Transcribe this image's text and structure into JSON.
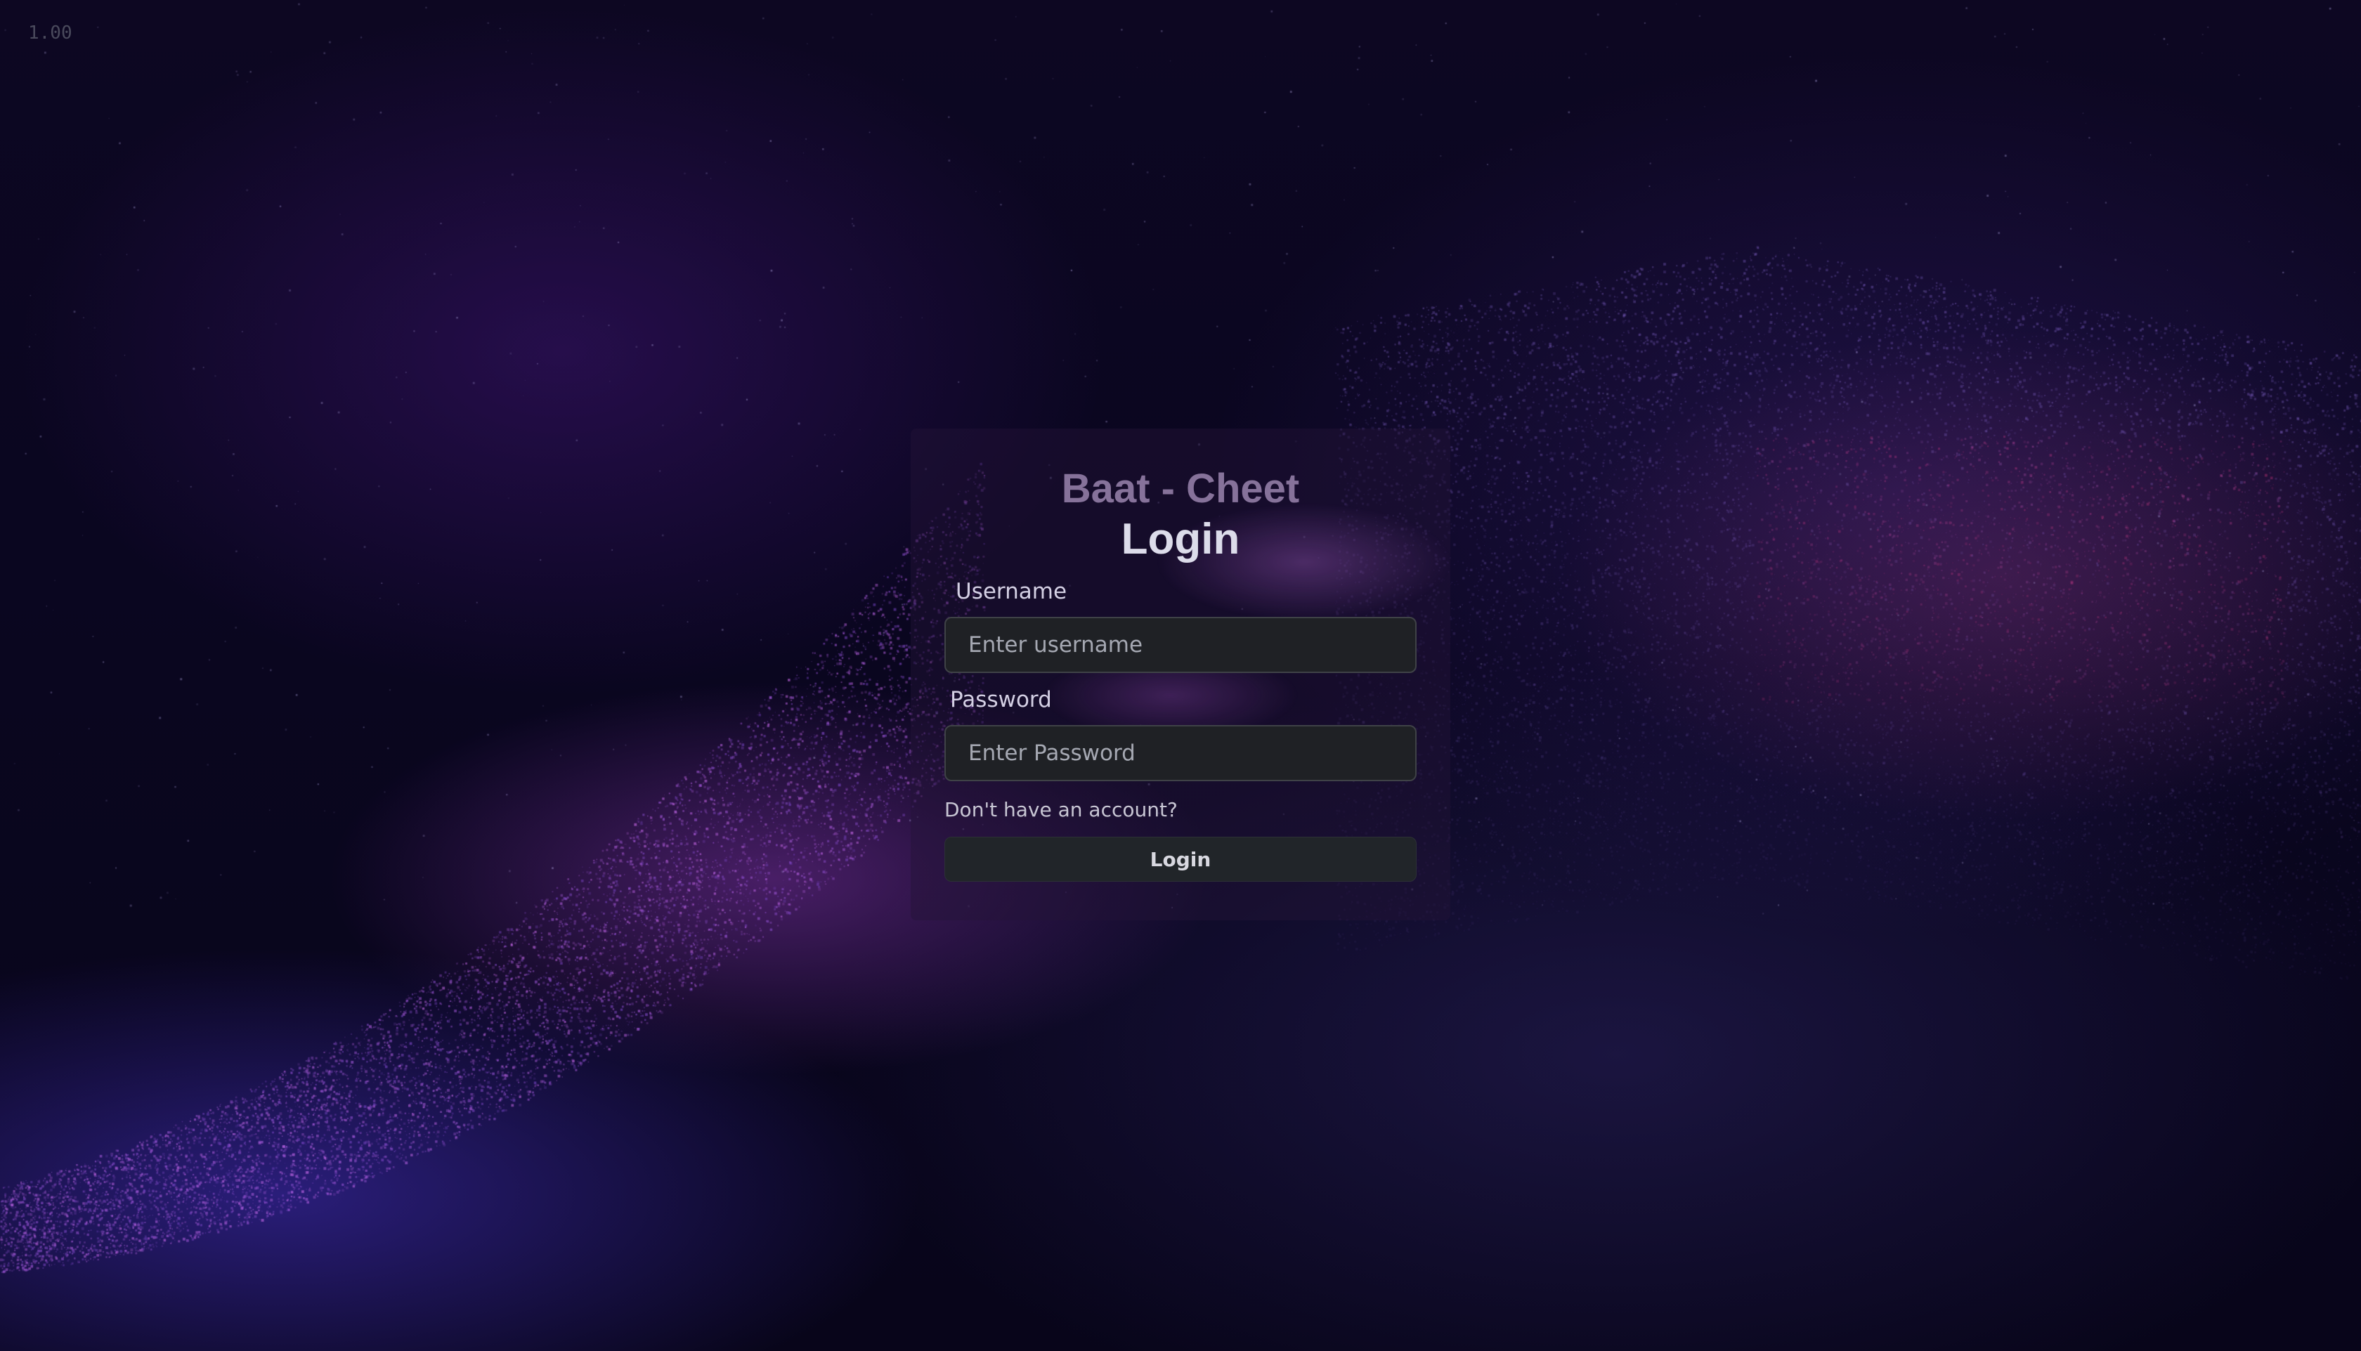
{
  "version_label": "1.00",
  "login_card": {
    "brand_title": "Baat - Cheet",
    "heading": "Login",
    "username": {
      "label": "Username",
      "placeholder": "Enter username",
      "value": ""
    },
    "password": {
      "label": "Password",
      "placeholder": "Enter Password",
      "value": ""
    },
    "signup_link": "Don't have an account?",
    "submit_label": "Login"
  },
  "colors": {
    "background": "#07051a",
    "brand_title": "#86729a",
    "heading": "#dcdcea",
    "input_background": "#1f2125",
    "button_background": "#212529"
  }
}
